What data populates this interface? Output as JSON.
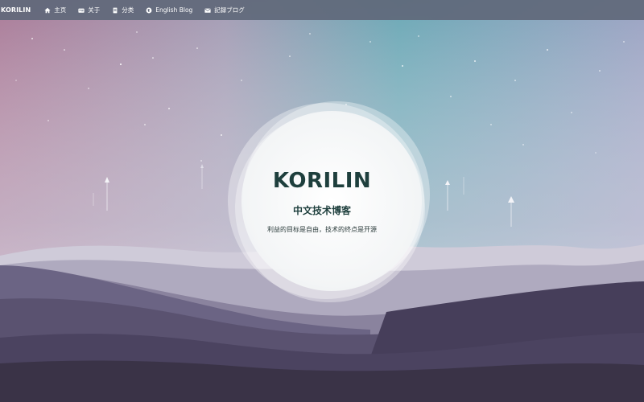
{
  "nav": {
    "brand": "KORILIN",
    "items": [
      {
        "label": "主页",
        "icon": "home-icon"
      },
      {
        "label": "关于",
        "icon": "id-card-icon"
      },
      {
        "label": "分类",
        "icon": "book-icon"
      },
      {
        "label": "English Blog",
        "icon": "globe-icon"
      },
      {
        "label": "記録ブログ",
        "icon": "mail-icon"
      }
    ]
  },
  "hero": {
    "title": "KORILIN",
    "subtitle": "中文技术博客",
    "motto": "利益的目标是自由，技术的终点是开源"
  },
  "colors": {
    "navbar": "#60687a",
    "title": "#1e3f3d",
    "mountain_dark": "#3a3347",
    "sky_teal": "#6aa8b4",
    "sky_pink": "#b27a96"
  }
}
